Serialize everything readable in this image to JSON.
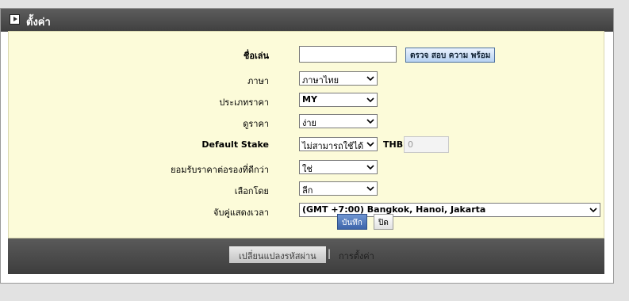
{
  "header": {
    "title": "ตั้งค่า",
    "icon": "play-icon"
  },
  "form": {
    "nickname": {
      "label": "ชื่อเล่น",
      "value": "",
      "check_button": "ตรวจ สอบ ความ พร้อม"
    },
    "language": {
      "label": "ภาษา",
      "value": "ภาษาไทย"
    },
    "odds_type": {
      "label": "ประเภทราคา",
      "value": "MY"
    },
    "odds_view": {
      "label": "ดูราคา",
      "value": "ง่าย"
    },
    "default_stake": {
      "label": "Default Stake",
      "value": "ไม่สามารถใช้ได้",
      "currency": "THB",
      "amount_placeholder": "0"
    },
    "accept_better_odds": {
      "label": "ยอมรับราคาต่อรองที่ดีกว่า",
      "value": "ใช่"
    },
    "sort_by": {
      "label": "เลือกโดย",
      "value": "ลีก"
    },
    "timezone": {
      "label": "จับคู่แสดงเวลา",
      "value": "(GMT +7:00) Bangkok, Hanoi, Jakarta"
    }
  },
  "buttons": {
    "save": "บันทึก",
    "close": "ปิด"
  },
  "footer": {
    "tab_password": "เปลี่ยนแปลงรหัสผ่าน",
    "separator": "|",
    "tab_settings": "การตั้งค่า"
  },
  "colors": {
    "content_bg": "#fcfbd9",
    "header_bg": "#4a4a4a",
    "save_button": "#4a72b8"
  }
}
